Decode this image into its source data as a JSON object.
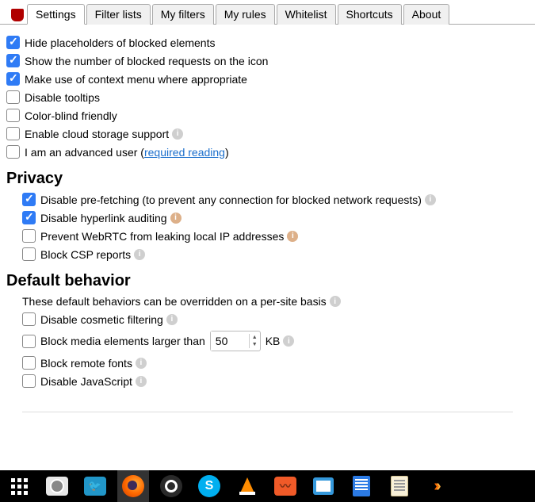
{
  "tabs": {
    "settings": "Settings",
    "filter_lists": "Filter lists",
    "my_filters": "My filters",
    "my_rules": "My rules",
    "whitelist": "Whitelist",
    "shortcuts": "Shortcuts",
    "about": "About"
  },
  "general": {
    "hide_placeholders": "Hide placeholders of blocked elements",
    "show_blocked_count": "Show the number of blocked requests on the icon",
    "context_menu": "Make use of context menu where appropriate",
    "disable_tooltips": "Disable tooltips",
    "color_blind": "Color-blind friendly",
    "cloud_storage": "Enable cloud storage support",
    "advanced_user_pre": "I am an advanced user (",
    "advanced_user_link": "required reading",
    "advanced_user_post": ")"
  },
  "privacy": {
    "heading": "Privacy",
    "prefetch": "Disable pre-fetching (to prevent any connection for blocked network requests)",
    "hyperlink_audit": "Disable hyperlink auditing",
    "webrtc": "Prevent WebRTC from leaking local IP addresses",
    "csp": "Block CSP reports"
  },
  "default_behavior": {
    "heading": "Default behavior",
    "intro": "These default behaviors can be overridden on a per-site basis",
    "cosmetic": "Disable cosmetic filtering",
    "block_media": "Block media elements larger than",
    "media_kb": "KB",
    "media_value": "50",
    "remote_fonts": "Block remote fonts",
    "disable_js": "Disable JavaScript"
  },
  "taskbar": {
    "skype_letter": "S"
  }
}
